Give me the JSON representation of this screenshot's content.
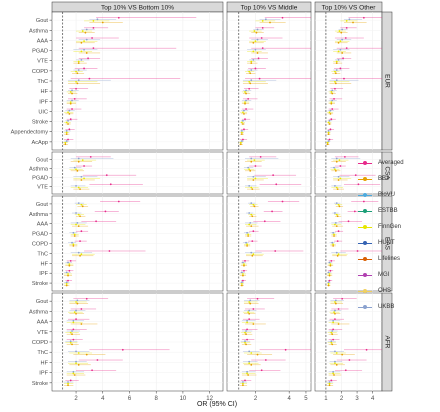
{
  "chart_data": {
    "type": "scatter",
    "x_label": "OR (95% CI)",
    "panels": [
      {
        "title": "Top 10% VS Bottom 10%",
        "x_ticks": [
          2,
          4,
          6,
          8,
          10,
          12
        ],
        "x_range": [
          0.2,
          13
        ]
      },
      {
        "title": "Top 10% VS Middle",
        "x_ticks": [
          2,
          4,
          5
        ],
        "x_range": [
          0.3,
          5.3
        ]
      },
      {
        "title": "Top 10% VS Other",
        "x_ticks": [
          1,
          2,
          3,
          4
        ],
        "x_range": [
          0.3,
          4.6
        ]
      }
    ],
    "reference_lines": [
      1,
      1,
      1
    ],
    "row_groups": [
      {
        "name": "EUR",
        "outcomes": [
          "Gout",
          "Asthma",
          "AAA",
          "PGAD",
          "VTE",
          "COPD",
          "ThC",
          "HF",
          "IPF",
          "UIC",
          "Stroke",
          "Appendectomy",
          "AcApp"
        ]
      },
      {
        "name": "CSA",
        "outcomes": [
          "Gout",
          "Asthma",
          "PGAD",
          "VTE"
        ]
      },
      {
        "name": "EAS",
        "outcomes": [
          "Gout",
          "Asthma",
          "AAA",
          "PGAD",
          "COPD",
          "ThC",
          "HF",
          "IPF",
          "Stroke"
        ]
      },
      {
        "name": "AFR",
        "outcomes": [
          "Gout",
          "Asthma",
          "AAA",
          "VTE",
          "COPD",
          "ThC",
          "HF",
          "IPF",
          "Stroke"
        ]
      }
    ],
    "cohorts": [
      {
        "name": "Averaged",
        "color": "#e7298a"
      },
      {
        "name": "BBJ",
        "color": "#e6a000"
      },
      {
        "name": "BioVU",
        "color": "#4daadd"
      },
      {
        "name": "ESTBB",
        "color": "#1b9e77"
      },
      {
        "name": "FinnGen",
        "color": "#e6e600"
      },
      {
        "name": "HUNT",
        "color": "#3563b3"
      },
      {
        "name": "Lifelines",
        "color": "#d95f02"
      },
      {
        "name": "MGI",
        "color": "#b040b0"
      },
      {
        "name": "OHS",
        "color": "#f0d060"
      },
      {
        "name": "UKBB",
        "color": "#8ba2cf"
      }
    ],
    "estimates": {
      "EUR": [
        [
          [
            5.2,
            3.5,
            11.0
          ],
          [
            3.6,
            3.0,
            5.0
          ],
          [
            3.3,
            2.6,
            4.5
          ],
          [
            4.0,
            3.0,
            5.5
          ]
        ],
        [
          [
            3.3,
            2.6,
            4.4
          ],
          [
            2.8,
            2.4,
            3.4
          ],
          [
            2.5,
            2.0,
            3.2
          ],
          [
            2.7,
            2.2,
            3.4
          ]
        ],
        [
          [
            3.2,
            2.0,
            5.2
          ],
          [
            2.8,
            2.2,
            3.8
          ],
          [
            2.6,
            2.0,
            3.6
          ],
          [
            2.4,
            2.0,
            3.4
          ]
        ],
        [
          [
            3.3,
            2.2,
            9.5
          ],
          [
            2.6,
            1.8,
            3.6
          ],
          [
            2.4,
            1.8,
            3.2
          ],
          [
            2.8,
            2.2,
            3.8
          ]
        ],
        [
          [
            2.9,
            2.2,
            3.8
          ],
          [
            2.4,
            2.0,
            3.0
          ],
          [
            2.2,
            1.8,
            2.6
          ],
          [
            2.2,
            1.8,
            2.8
          ]
        ],
        [
          [
            2.6,
            1.9,
            3.6
          ],
          [
            2.2,
            1.8,
            2.8
          ],
          [
            2.0,
            1.6,
            2.5
          ],
          [
            2.1,
            1.7,
            2.6
          ]
        ],
        [
          [
            3.0,
            1.6,
            9.8
          ],
          [
            2.2,
            1.4,
            4.6
          ],
          [
            2.0,
            1.4,
            3.6
          ],
          [
            2.1,
            1.4,
            3.8
          ]
        ],
        [
          [
            2.0,
            1.5,
            2.9
          ],
          [
            1.7,
            1.4,
            2.2
          ],
          [
            1.6,
            1.3,
            2.0
          ],
          [
            1.7,
            1.4,
            2.1
          ]
        ],
        [
          [
            1.9,
            1.4,
            2.8
          ],
          [
            1.7,
            1.3,
            2.2
          ],
          [
            1.6,
            1.3,
            2.0
          ],
          [
            1.6,
            1.3,
            2.0
          ]
        ],
        [
          [
            1.7,
            1.3,
            2.4
          ],
          [
            1.5,
            1.2,
            1.9
          ],
          [
            1.4,
            1.1,
            1.8
          ],
          [
            1.5,
            1.2,
            1.8
          ]
        ],
        [
          [
            1.6,
            1.3,
            2.1
          ],
          [
            1.4,
            1.2,
            1.7
          ],
          [
            1.3,
            1.1,
            1.6
          ],
          [
            1.4,
            1.2,
            1.6
          ]
        ],
        [
          [
            1.5,
            1.2,
            1.9
          ],
          [
            1.3,
            1.1,
            1.6
          ],
          [
            1.3,
            1.1,
            1.5
          ],
          [
            1.3,
            1.1,
            1.5
          ]
        ],
        [
          [
            1.4,
            1.1,
            1.8
          ],
          [
            1.3,
            1.1,
            1.5
          ],
          [
            1.2,
            1.0,
            1.4
          ],
          [
            1.2,
            1.0,
            1.4
          ]
        ]
      ],
      "CSA": [
        [
          [
            3.1,
            2.0,
            4.6
          ],
          [
            2.2,
            1.6,
            4.8
          ],
          [
            2.5,
            1.8,
            3.5
          ],
          [
            2.2,
            1.6,
            3.2
          ]
        ],
        [
          [
            2.6,
            2.0,
            3.2
          ],
          [
            1.9,
            1.5,
            2.4
          ],
          [
            2.0,
            1.5,
            2.5
          ],
          [
            2.1,
            1.6,
            2.6
          ]
        ],
        [
          [
            4.3,
            2.5,
            6.5
          ],
          [
            2.4,
            1.8,
            3.6
          ],
          [
            2.6,
            1.8,
            3.8
          ],
          [
            2.4,
            1.8,
            3.4
          ]
        ],
        [
          [
            4.6,
            3.0,
            7.0
          ],
          [
            2.0,
            1.6,
            2.7
          ],
          [
            2.2,
            1.6,
            2.9
          ],
          [
            2.3,
            1.8,
            3.0
          ]
        ]
      ],
      "EAS": [
        [
          [
            5.2,
            3.8,
            6.8
          ],
          [
            2.2,
            1.9,
            2.6
          ],
          [
            2.4,
            2.0,
            2.8
          ],
          [
            2.5,
            2.1,
            2.9
          ]
        ],
        [
          [
            4.2,
            3.4,
            5.2
          ],
          [
            2.0,
            1.7,
            2.4
          ],
          [
            2.2,
            1.9,
            2.6
          ],
          [
            2.3,
            2.0,
            2.7
          ]
        ],
        [
          [
            3.5,
            2.4,
            5.0
          ],
          [
            2.1,
            1.6,
            2.8
          ],
          [
            2.0,
            1.6,
            2.7
          ],
          [
            2.2,
            1.7,
            2.9
          ]
        ],
        [
          [
            2.4,
            2.0,
            2.9
          ],
          [
            1.8,
            1.5,
            2.1
          ],
          [
            1.9,
            1.6,
            2.2
          ],
          [
            1.9,
            1.6,
            2.2
          ]
        ],
        [
          [
            2.3,
            1.9,
            2.8
          ],
          [
            1.7,
            1.4,
            2.0
          ],
          [
            1.8,
            1.5,
            2.1
          ],
          [
            1.8,
            1.5,
            2.1
          ]
        ],
        [
          [
            4.5,
            2.6,
            7.2
          ],
          [
            2.2,
            1.6,
            3.2
          ],
          [
            2.4,
            1.7,
            3.4
          ],
          [
            2.3,
            1.7,
            3.3
          ]
        ],
        [
          [
            1.6,
            1.3,
            2.0
          ],
          [
            1.4,
            1.2,
            1.7
          ],
          [
            1.5,
            1.2,
            1.8
          ],
          [
            1.5,
            1.2,
            1.8
          ]
        ],
        [
          [
            1.5,
            1.2,
            1.8
          ],
          [
            1.3,
            1.1,
            1.6
          ],
          [
            1.4,
            1.1,
            1.7
          ],
          [
            1.4,
            1.1,
            1.7
          ]
        ],
        [
          [
            1.4,
            1.2,
            1.7
          ],
          [
            1.3,
            1.1,
            1.5
          ],
          [
            1.3,
            1.1,
            1.5
          ],
          [
            1.3,
            1.1,
            1.5
          ]
        ]
      ],
      "AFR": [
        [
          [
            2.8,
            1.8,
            4.4
          ],
          [
            2.1,
            1.5,
            3.0
          ],
          [
            2.0,
            1.5,
            2.8
          ],
          [
            2.1,
            1.5,
            2.9
          ]
        ],
        [
          [
            2.4,
            1.6,
            3.5
          ],
          [
            2.0,
            1.5,
            2.7
          ],
          [
            1.9,
            1.4,
            2.5
          ],
          [
            2.0,
            1.5,
            2.6
          ]
        ],
        [
          [
            2.0,
            1.4,
            3.0
          ],
          [
            1.8,
            1.3,
            2.6
          ],
          [
            1.8,
            1.3,
            2.5
          ],
          [
            2.4,
            1.6,
            3.6
          ]
        ],
        [
          [
            1.8,
            1.3,
            2.8
          ],
          [
            1.7,
            1.3,
            2.3
          ],
          [
            1.6,
            1.2,
            2.2
          ],
          [
            1.7,
            1.3,
            2.3
          ]
        ],
        [
          [
            1.8,
            1.3,
            2.5
          ],
          [
            1.6,
            1.2,
            2.1
          ],
          [
            1.6,
            1.2,
            2.1
          ],
          [
            1.7,
            1.3,
            2.2
          ]
        ],
        [
          [
            5.5,
            3.0,
            9.0
          ],
          [
            2.0,
            1.4,
            3.0
          ],
          [
            2.2,
            1.5,
            3.2
          ],
          [
            2.8,
            1.8,
            4.2
          ]
        ],
        [
          [
            3.6,
            2.2,
            5.5
          ],
          [
            2.0,
            1.4,
            2.8
          ],
          [
            2.0,
            1.4,
            2.9
          ],
          [
            2.2,
            1.5,
            3.1
          ]
        ],
        [
          [
            3.2,
            2.0,
            5.0
          ],
          [
            1.8,
            1.3,
            2.6
          ],
          [
            1.8,
            1.3,
            2.6
          ],
          [
            1.9,
            1.3,
            2.7
          ]
        ],
        [
          [
            1.6,
            1.2,
            2.2
          ],
          [
            1.4,
            1.1,
            1.8
          ],
          [
            1.4,
            1.1,
            1.8
          ],
          [
            1.4,
            1.1,
            1.8
          ]
        ]
      ]
    },
    "estimate_cohorts": [
      "Averaged",
      "UKBB",
      "FinnGen",
      "BBJ"
    ],
    "grid": true,
    "legend_position": "right"
  }
}
